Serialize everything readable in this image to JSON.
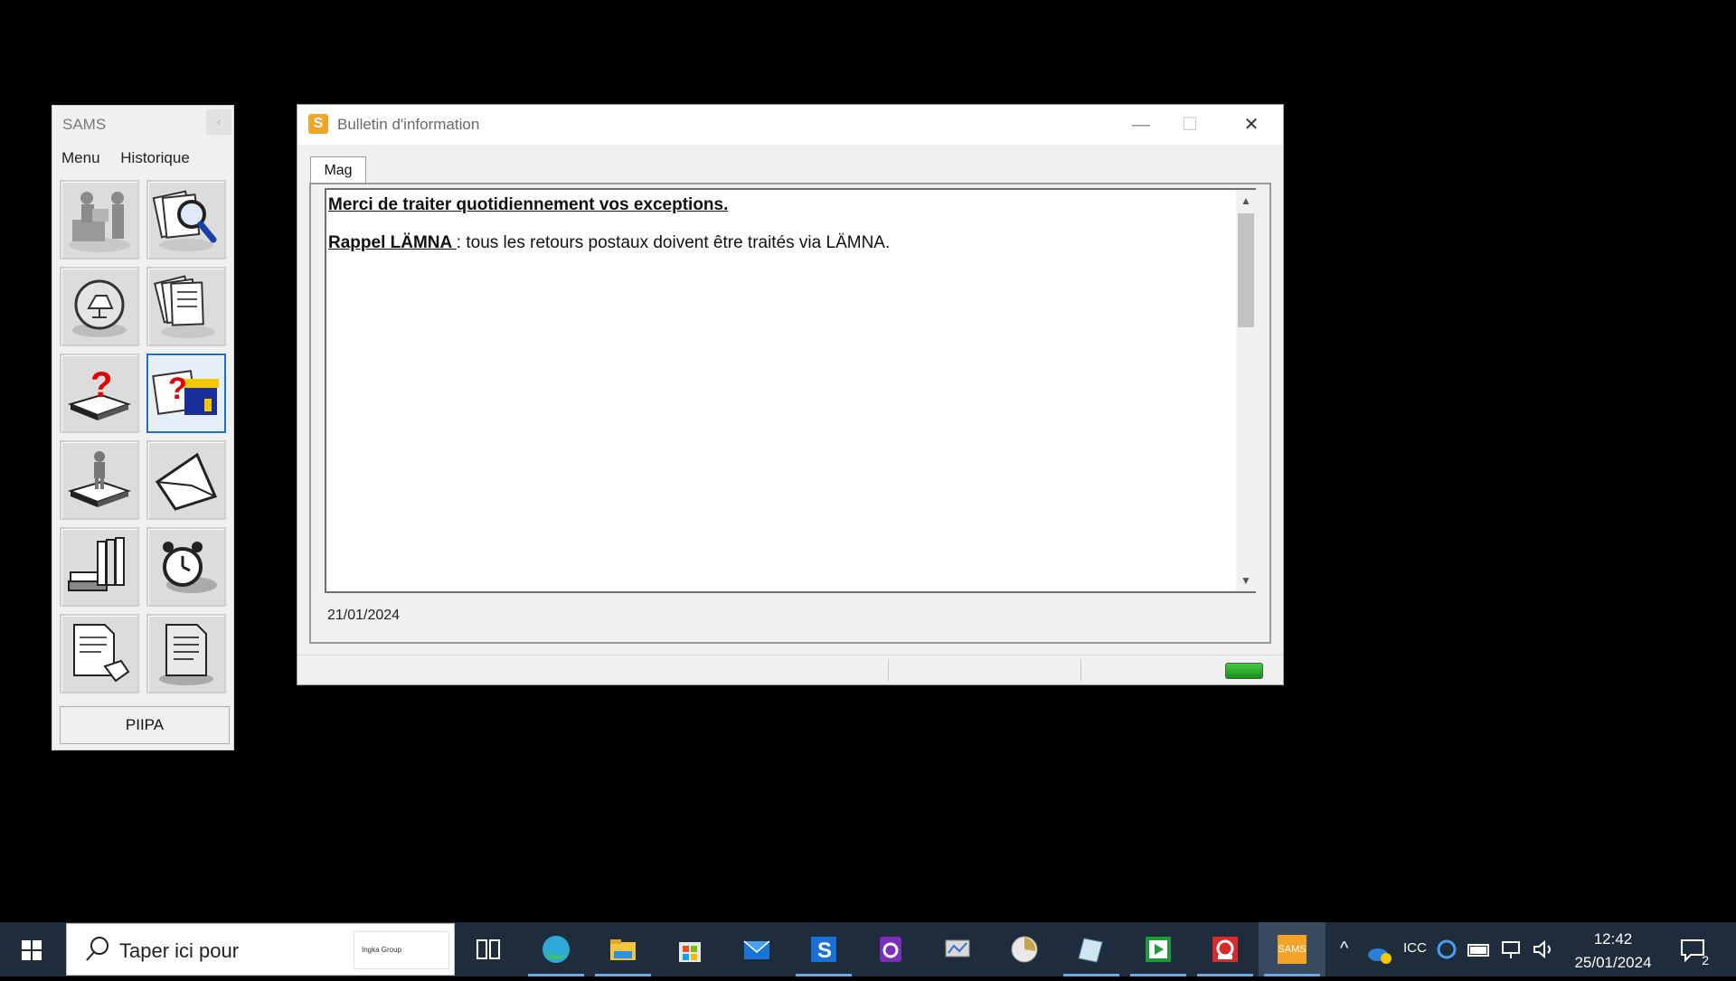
{
  "sams_panel": {
    "title": "SAMS",
    "collapse_glyph": "‹",
    "menu": [
      "Menu",
      "Historique"
    ],
    "tiles": [
      {
        "icon": "worker-at-desk-icon"
      },
      {
        "icon": "documents-magnifier-icon"
      },
      {
        "icon": "lamp-magnifier-icon"
      },
      {
        "icon": "document-stack-icon"
      },
      {
        "icon": "question-on-tray-icon"
      },
      {
        "icon": "question-store-icon"
      },
      {
        "icon": "person-on-tray-icon"
      },
      {
        "icon": "envelope-icon"
      },
      {
        "icon": "binders-books-icon"
      },
      {
        "icon": "alarm-clock-icon"
      },
      {
        "icon": "document-hand-icon"
      },
      {
        "icon": "printed-document-icon"
      }
    ],
    "selected_tile": 5,
    "bottom_button": "PIIPA"
  },
  "bulletin_window": {
    "app_icon_letter": "S",
    "title": "Bulletin d'information",
    "controls": {
      "minimize": "—",
      "maximize": "☐",
      "close": "✕"
    },
    "tab": "Mag",
    "message_heading": "Merci de traiter quotidiennement vos exceptions.",
    "reminder_label": "Rappel LÄMNA ",
    "reminder_text": ": tous les retours postaux doivent être traités via LÄMNA.",
    "date": "21/01/2024",
    "status_led_color": "#2ea82e"
  },
  "taskbar": {
    "search_placeholder": "Taper ici pour",
    "search_badge": "Ingka Group",
    "apps": [
      {
        "name": "task-view"
      },
      {
        "name": "edge",
        "active": true
      },
      {
        "name": "file-explorer",
        "active": true
      },
      {
        "name": "microsoft-store"
      },
      {
        "name": "mail"
      },
      {
        "name": "sams-s",
        "active": true
      },
      {
        "name": "purple-app"
      },
      {
        "name": "monitor-app"
      },
      {
        "name": "clock-app"
      },
      {
        "name": "paper-app",
        "active": true
      },
      {
        "name": "play-app",
        "active": true
      },
      {
        "name": "support-app",
        "active": true
      },
      {
        "name": "sams",
        "active": true,
        "label": "SAMS"
      }
    ],
    "tray_language": "ICC",
    "time": "12:42",
    "date": "25/01/2024",
    "notifications": "2"
  }
}
